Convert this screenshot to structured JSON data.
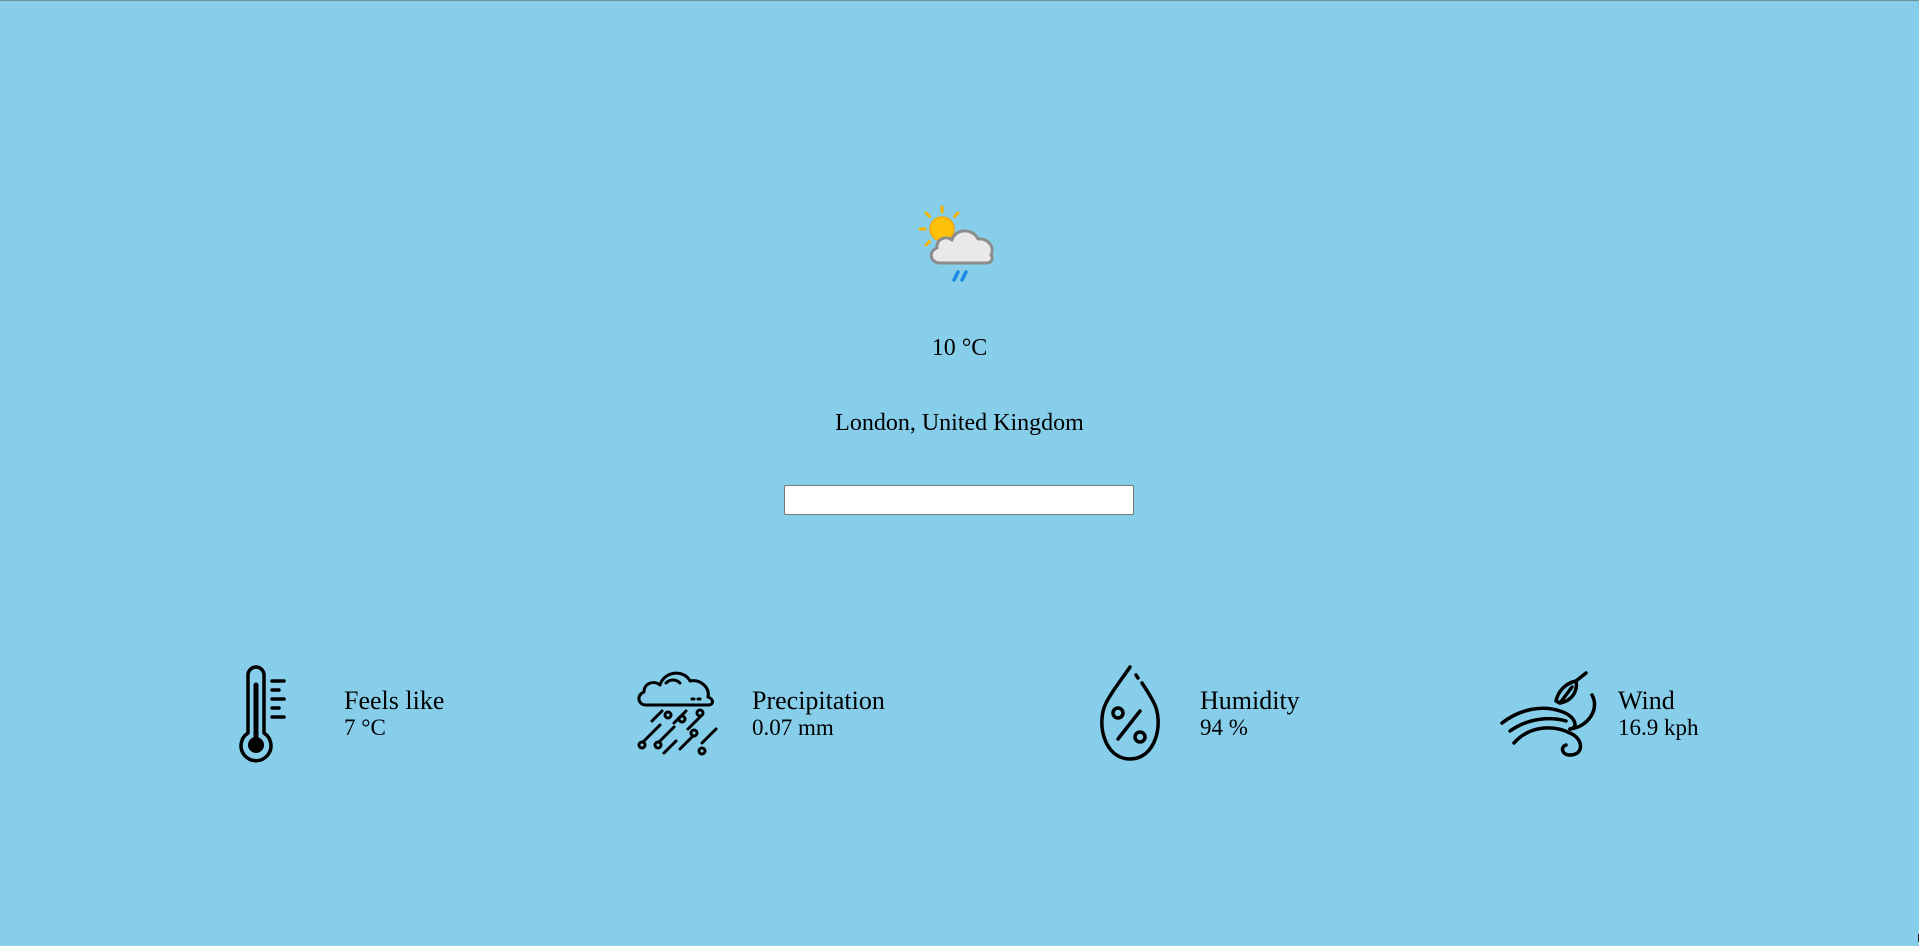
{
  "current": {
    "condition_icon": "sun-cloud-rain-icon",
    "temperature": "10 °C",
    "location": "London, United Kingdom"
  },
  "search": {
    "value": "",
    "placeholder": ""
  },
  "stats": [
    {
      "icon": "thermometer-icon",
      "title": "Feels like",
      "value": "7 °C"
    },
    {
      "icon": "cloud-rain-icon",
      "title": "Precipitation",
      "value": "0.07 mm"
    },
    {
      "icon": "humidity-drop-icon",
      "title": "Humidity",
      "value": "94 %"
    },
    {
      "icon": "wind-icon",
      "title": "Wind",
      "value": "16.9 kph"
    }
  ],
  "colors": {
    "background": "#87ceeb",
    "sun": "#ffc107",
    "cloud": "#e6e6e6",
    "rain": "#1e88e5"
  }
}
